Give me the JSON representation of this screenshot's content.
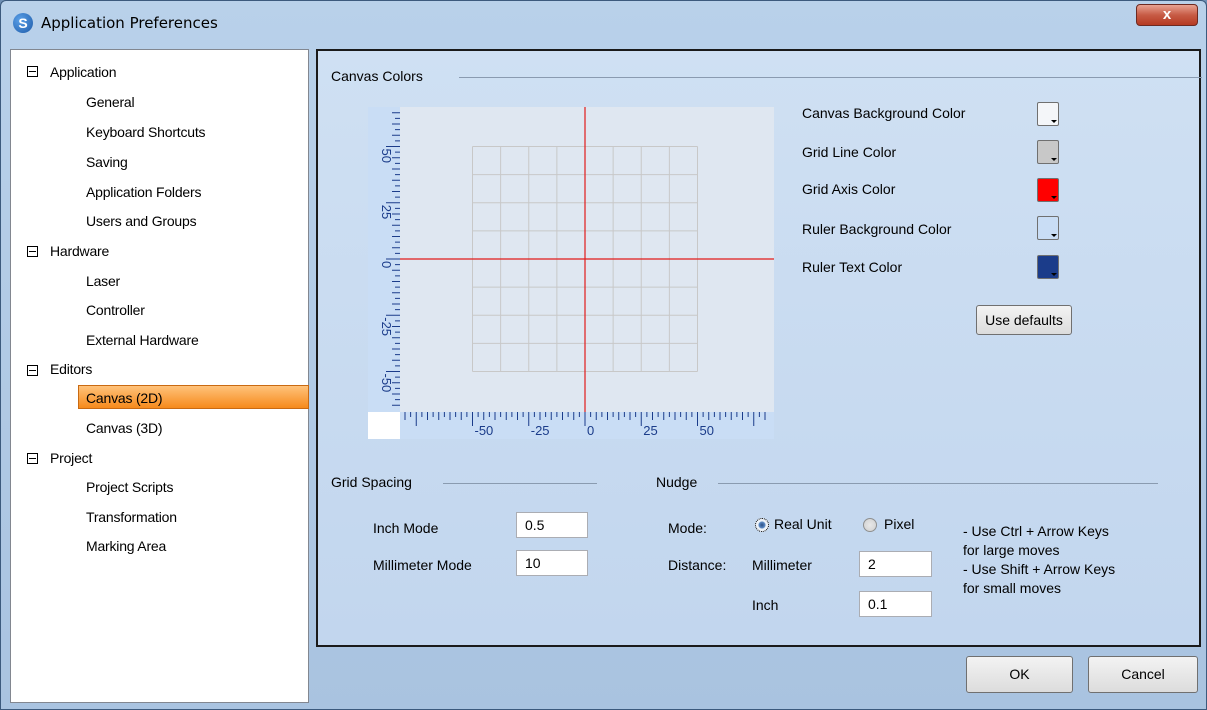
{
  "window": {
    "title": "Application Preferences",
    "close_glyph": "x"
  },
  "tree": {
    "expander_glyph": "−",
    "items": [
      {
        "label": "Application",
        "level": 0
      },
      {
        "label": "General",
        "level": 1
      },
      {
        "label": "Keyboard Shortcuts",
        "level": 1
      },
      {
        "label": "Saving",
        "level": 1
      },
      {
        "label": "Application Folders",
        "level": 1
      },
      {
        "label": "Users and Groups",
        "level": 1
      },
      {
        "label": "Hardware",
        "level": 0
      },
      {
        "label": "Laser",
        "level": 1
      },
      {
        "label": "Controller",
        "level": 1
      },
      {
        "label": "External Hardware",
        "level": 1
      },
      {
        "label": "Editors",
        "level": 0
      },
      {
        "label": "Canvas (2D)",
        "level": 1,
        "selected": true
      },
      {
        "label": "Canvas (3D)",
        "level": 1
      },
      {
        "label": "Project",
        "level": 0
      },
      {
        "label": "Project Scripts",
        "level": 1
      },
      {
        "label": "Transformation",
        "level": 1
      },
      {
        "label": "Marking Area",
        "level": 1
      }
    ]
  },
  "canvas_colors": {
    "header": "Canvas Colors",
    "preview": {
      "y_ruler_labels": [
        "50",
        "25",
        "0",
        "-25",
        "-50"
      ],
      "x_ruler_labels": [
        "-50",
        "-25",
        "0",
        "25",
        "50"
      ]
    },
    "colors": [
      {
        "label": "Canvas Background Color",
        "color": "#f4f6f9"
      },
      {
        "label": "Grid Line Color",
        "color": "#c8c8c8"
      },
      {
        "label": "Grid Axis Color",
        "color": "#ff0000"
      },
      {
        "label": "Ruler Background Color",
        "color": "#c9ddf5"
      },
      {
        "label": "Ruler Text Color",
        "color": "#1b3c8a"
      }
    ],
    "use_defaults_label": "Use defaults"
  },
  "grid_spacing": {
    "header": "Grid Spacing",
    "inch_label": "Inch Mode",
    "inch_value": "0.5",
    "mm_label": "Millimeter Mode",
    "mm_value": "10"
  },
  "nudge": {
    "header": "Nudge",
    "mode_label": "Mode:",
    "real_unit_label": "Real Unit",
    "pixel_label": "Pixel",
    "distance_label": "Distance:",
    "mm_label": "Millimeter",
    "mm_value": "2",
    "inch_label": "Inch",
    "inch_value": "0.1",
    "hints": [
      "- Use Ctrl + Arrow Keys",
      "for large moves",
      "- Use Shift + Arrow Keys",
      "for small moves"
    ]
  },
  "footer": {
    "ok_label": "OK",
    "cancel_label": "Cancel"
  },
  "colors": {
    "axis": "#e21b1b",
    "grid": "#c8c8c8",
    "ruler_bg": "#c9ddf5",
    "ruler_text": "#1b3c8a"
  }
}
